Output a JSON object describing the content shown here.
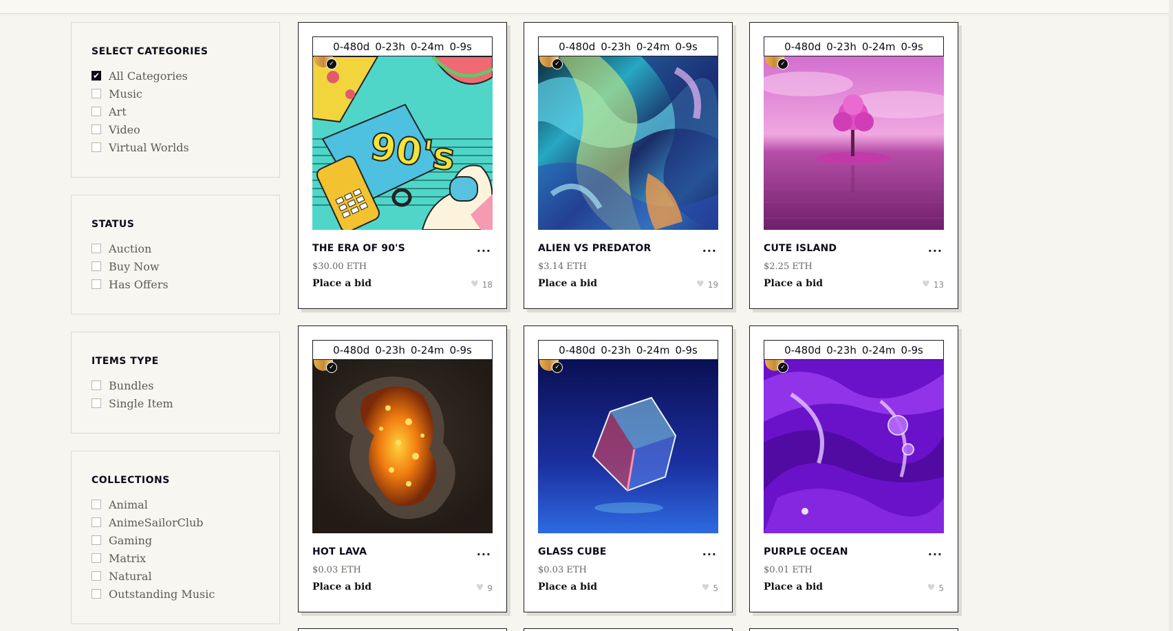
{
  "filters": [
    {
      "title": "Select Categories",
      "options": [
        {
          "label": "All Categories",
          "checked": true
        },
        {
          "label": "Music",
          "checked": false
        },
        {
          "label": "Art",
          "checked": false
        },
        {
          "label": "Video",
          "checked": false
        },
        {
          "label": "Virtual Worlds",
          "checked": false
        }
      ]
    },
    {
      "title": "Status",
      "options": [
        {
          "label": "Auction",
          "checked": false
        },
        {
          "label": "Buy Now",
          "checked": false
        },
        {
          "label": "Has Offers",
          "checked": false
        }
      ]
    },
    {
      "title": "Items Type",
      "options": [
        {
          "label": "Bundles",
          "checked": false
        },
        {
          "label": "Single Item",
          "checked": false
        }
      ]
    },
    {
      "title": "Collections",
      "options": [
        {
          "label": "Animal",
          "checked": false
        },
        {
          "label": "AnimeSailorClub",
          "checked": false
        },
        {
          "label": "Gaming",
          "checked": false
        },
        {
          "label": "Matrix",
          "checked": false
        },
        {
          "label": "Natural",
          "checked": false
        },
        {
          "label": "Outstanding Music",
          "checked": false
        }
      ]
    }
  ],
  "countdown": {
    "days": "0-480d",
    "hours": "0-23h",
    "minutes": "0-24m",
    "seconds": "0-9s"
  },
  "cards": [
    {
      "title": "The Era of 90's",
      "price": "$30.00 ETH",
      "action": "Place a bid",
      "likes": "18",
      "art": "retro-90s",
      "more": "..."
    },
    {
      "title": "Alien vs Predator",
      "price": "$3.14 ETH",
      "action": "Place a bid",
      "likes": "19",
      "art": "chrome-waves",
      "more": "..."
    },
    {
      "title": "Cute Island",
      "price": "$2.25 ETH",
      "action": "Place a bid",
      "likes": "13",
      "art": "pink-island",
      "more": "..."
    },
    {
      "title": "Hot Lava",
      "price": "$0.03 ETH",
      "action": "Place a bid",
      "likes": "9",
      "art": "lava-rock",
      "more": "..."
    },
    {
      "title": "Glass Cube",
      "price": "$0.03 ETH",
      "action": "Place a bid",
      "likes": "5",
      "art": "glass-cube",
      "more": "..."
    },
    {
      "title": "Purple Ocean",
      "price": "$0.01 ETH",
      "action": "Place a bid",
      "likes": "5",
      "art": "purple-liquid",
      "more": "..."
    }
  ],
  "icons": {
    "verified": "check-badge-icon",
    "like": "heart-icon",
    "more": "ellipsis-icon",
    "checkbox_checked": "check-icon"
  }
}
